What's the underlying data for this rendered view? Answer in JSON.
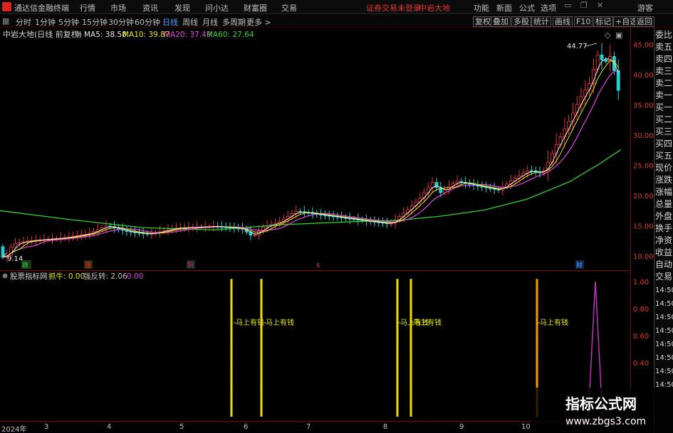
{
  "menubar": {
    "app_title": "通达信金融终端",
    "menus": [
      "行情",
      "市场",
      "资讯",
      "发现",
      "问小达",
      "财富圈",
      "交易"
    ],
    "notice": "证券交易未登录",
    "stock_name": "中岩大地",
    "right_menus": [
      "功能",
      "新面",
      "公式",
      "选项"
    ],
    "user": "游客"
  },
  "periodbar": {
    "periods": [
      "分时",
      "1分钟",
      "5分钟",
      "15分钟",
      "30分钟",
      "60分钟",
      "日线",
      "周线",
      "月线",
      "多周期",
      "更多 >"
    ],
    "active": "日线",
    "tools": [
      "复权",
      "叠加",
      "多股",
      "统计",
      "画线",
      "F10",
      "标记",
      "+自选",
      "返回"
    ]
  },
  "main_chart": {
    "title": "中岩大地(日线 前复权)",
    "ma": [
      {
        "label": "MA5: 38.58",
        "color": "#e8e8e8"
      },
      {
        "label": "MA10: 39.87",
        "color": "#e8e800"
      },
      {
        "label": "MA20: 37.49",
        "color": "#e040e0"
      },
      {
        "label": "MA60: 27.64",
        "color": "#30d030"
      }
    ],
    "high_label": "44.77",
    "low_label": "9.14",
    "event_markers": [
      {
        "text": "跌",
        "color": "#30d030"
      },
      {
        "text": "涨",
        "color": "#e0342b"
      },
      {
        "text": "阴",
        "color": "#e0342b"
      },
      {
        "text": "$",
        "color": "#e0342b"
      },
      {
        "text": "财",
        "color": "#4aa0ff"
      }
    ]
  },
  "y_axis": [
    "45.00",
    "40.00",
    "35.00",
    "30.00",
    "25.00",
    "20.00",
    "15.00",
    "10.00"
  ],
  "sub_chart": {
    "title": "股票指标网",
    "items": [
      {
        "label": "抓牛: 0.00",
        "color": "#e8e800"
      },
      {
        "label": "强反转: 2.06",
        "color": "#c0c0c0"
      },
      {
        "label": "0.00",
        "color": "#e040e0"
      }
    ],
    "annotation": "马上有钱",
    "y_axis": [
      "1.00",
      "0.80",
      "0.60",
      "0.40"
    ]
  },
  "side_panel": [
    "委比",
    "卖五",
    "卖四",
    "卖三",
    "卖二",
    "卖一",
    "买一",
    "买二",
    "买三",
    "买四",
    "买五",
    "现价",
    "涨跌",
    "涨幅",
    "总量",
    "外盘",
    "换手",
    "净资",
    "收益",
    "自动",
    "交易"
  ],
  "side_times": [
    "14:50",
    "14:50",
    "14:50",
    "14:50",
    "14:50",
    "14:50",
    "14:50",
    "14:50"
  ],
  "date_axis": [
    "2024年",
    "3",
    "4",
    "5",
    "6",
    "7",
    "8",
    "9",
    "10"
  ],
  "watermark": {
    "title": "指标公式网",
    "url": "www.zbgs3.com"
  },
  "chart_data": {
    "type": "candlestick",
    "price_ylim": [
      8,
      47
    ],
    "ma5_last": 38.58,
    "ma10_last": 39.87,
    "ma20_last": 37.49,
    "ma60_last": 27.64,
    "high": 44.77,
    "low": 9.14,
    "signal_ylim": [
      0,
      1.05
    ]
  }
}
